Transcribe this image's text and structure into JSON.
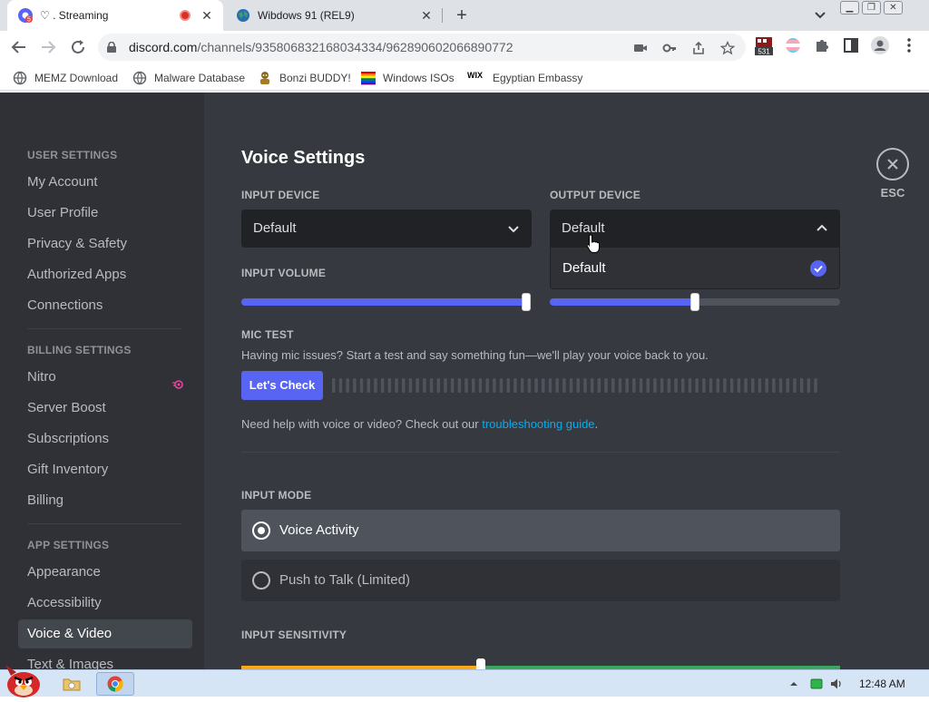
{
  "browser": {
    "tabs": [
      {
        "title": "♡ . Streaming",
        "recording": true
      },
      {
        "title": "Wibdows 91 (REL9)"
      }
    ],
    "tab_badge": "5",
    "url_host": "discord.com",
    "url_path": "/channels/935806832168034334/962890602066890772",
    "extension_badge": "531",
    "bookmarks": [
      "MEMZ Download",
      "Malware Database",
      "Bonzi BUDDY!",
      "Windows ISOs",
      "Egyptian Embassy"
    ],
    "bookmark_prefix": "WIX"
  },
  "sidebar": {
    "user_settings_header": "USER SETTINGS",
    "user_items": [
      "My Account",
      "User Profile",
      "Privacy & Safety",
      "Authorized Apps",
      "Connections"
    ],
    "billing_header": "BILLING SETTINGS",
    "billing_items": [
      "Nitro",
      "Server Boost",
      "Subscriptions",
      "Gift Inventory",
      "Billing"
    ],
    "app_header": "APP SETTINGS",
    "app_items": [
      "Appearance",
      "Accessibility",
      "Voice & Video",
      "Text & Images"
    ],
    "selected": "Voice & Video"
  },
  "voice": {
    "title": "Voice Settings",
    "input_device_label": "INPUT DEVICE",
    "input_device_value": "Default",
    "output_device_label": "OUTPUT DEVICE",
    "output_device_value": "Default",
    "output_dropdown_options": [
      "Default"
    ],
    "output_dropdown_selected": "Default",
    "input_volume_label": "INPUT VOLUME",
    "input_volume_level": 1.0,
    "output_volume_level": 0.5,
    "mic_test_label": "MIC TEST",
    "mic_test_desc": "Having mic issues? Start a test and say something fun—we'll play your voice back to you.",
    "lets_check": "Let's Check",
    "help_prefix": "Need help with voice or video? Check out our ",
    "help_link": "troubleshooting guide",
    "help_suffix": ".",
    "input_mode_label": "INPUT MODE",
    "modes": [
      "Voice Activity",
      "Push to Talk (Limited)"
    ],
    "selected_mode": "Voice Activity",
    "sensitivity_label": "INPUT SENSITIVITY",
    "sensitivity_level": 0.4
  },
  "esc_label": "ESC",
  "taskbar": {
    "clock": "12:48 AM"
  },
  "colors": {
    "accent": "#5865f2",
    "background": "#36393f",
    "sidebar": "#2f3136",
    "link": "#00aff4"
  }
}
